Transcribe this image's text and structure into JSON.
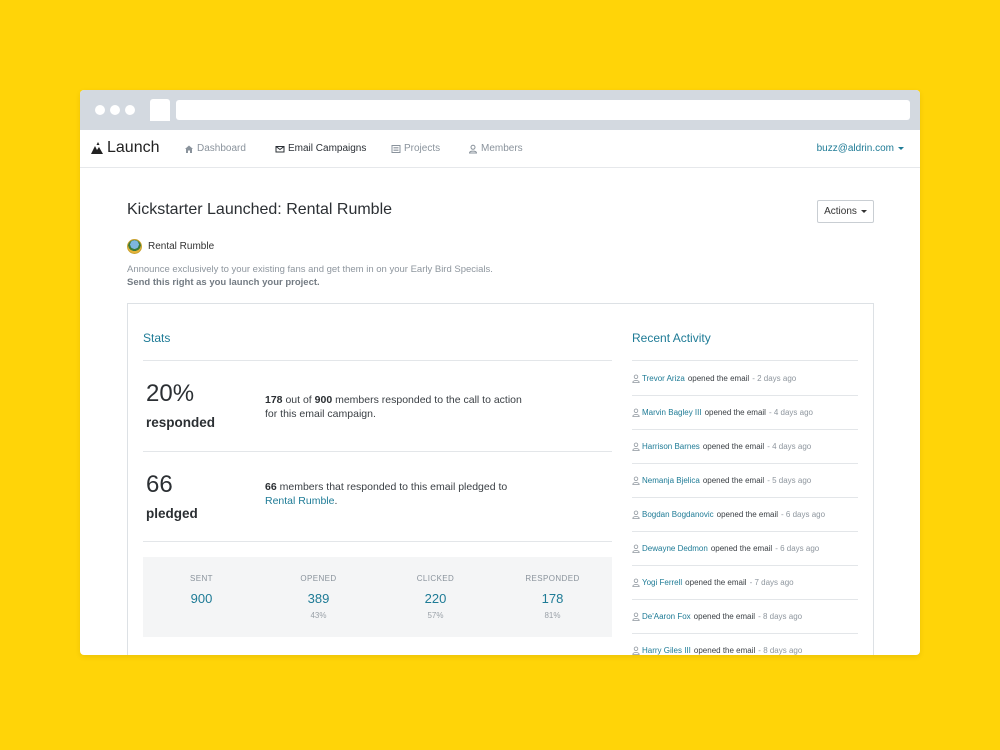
{
  "navbar": {
    "logo_text": "Launch",
    "items": [
      {
        "label": "Dashboard",
        "icon": "home-icon"
      },
      {
        "label": "Email Campaigns",
        "icon": "envelope-icon"
      },
      {
        "label": "Projects",
        "icon": "list-icon"
      },
      {
        "label": "Members",
        "icon": "user-icon"
      }
    ],
    "user_email": "buzz@aldrin.com"
  },
  "page": {
    "title": "Kickstarter Launched: Rental Rumble",
    "actions_label": "Actions",
    "project_name": "Rental Rumble",
    "description_line1": "Announce exclusively to your existing fans and get them in on your Early Bird Specials.",
    "description_line2": "Send this right as you launch your project."
  },
  "stats": {
    "title": "Stats",
    "responded": {
      "big": "20%",
      "label": "responded",
      "count": "178",
      "text_mid": " out of ",
      "total": "900",
      "text_end": " members responded to the call to action for this email campaign."
    },
    "pledged": {
      "big": "66",
      "label": "pledged",
      "count": "66",
      "text_mid": " members that responded to this email pledged to ",
      "link": "Rental Rumble",
      "text_end": "."
    },
    "summary": [
      {
        "head": "SENT",
        "value": "900",
        "pct": ""
      },
      {
        "head": "OPENED",
        "value": "389",
        "pct": "43%"
      },
      {
        "head": "CLICKED",
        "value": "220",
        "pct": "57%"
      },
      {
        "head": "RESPONDED",
        "value": "178",
        "pct": "81%"
      }
    ]
  },
  "activity": {
    "title": "Recent Activity",
    "items": [
      {
        "name": "Trevor Ariza",
        "action": "opened the email",
        "time": "2 days ago"
      },
      {
        "name": "Marvin Bagley III",
        "action": "opened the email",
        "time": "4 days ago"
      },
      {
        "name": "Harrison Barnes",
        "action": "opened the email",
        "time": "4 days ago"
      },
      {
        "name": "Nemanja Bjelica",
        "action": "opened the email",
        "time": "5 days ago"
      },
      {
        "name": "Bogdan Bogdanovic",
        "action": "opened the email",
        "time": "6 days ago"
      },
      {
        "name": "Dewayne Dedmon",
        "action": "opened the email",
        "time": "6 days ago"
      },
      {
        "name": "Yogi Ferrell",
        "action": "opened the email",
        "time": "7 days ago"
      },
      {
        "name": "De'Aaron Fox",
        "action": "opened the email",
        "time": "8 days ago"
      },
      {
        "name": "Harry Giles III",
        "action": "opened the email",
        "time": "8 days ago"
      }
    ]
  },
  "colors": {
    "background": "#FFD408",
    "accent": "#1E7B96"
  }
}
